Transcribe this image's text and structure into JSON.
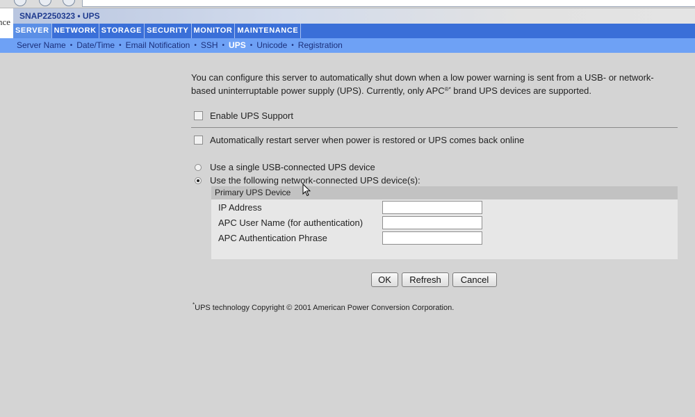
{
  "window": {
    "title": "SNAP2250323 • UPS",
    "logo_fragment": "nce"
  },
  "main_tabs": [
    {
      "label": "SERVER",
      "active": true
    },
    {
      "label": "NETWORK"
    },
    {
      "label": "STORAGE"
    },
    {
      "label": "SECURITY"
    },
    {
      "label": "MONITOR"
    },
    {
      "label": "MAINTENANCE"
    }
  ],
  "sub_nav": [
    {
      "label": "Server Name"
    },
    {
      "label": "Date/Time"
    },
    {
      "label": "Email Notification"
    },
    {
      "label": "SSH"
    },
    {
      "label": "UPS",
      "active": true
    },
    {
      "label": "Unicode"
    },
    {
      "label": "Registration"
    }
  ],
  "sub_nav_separator": "•",
  "intro": {
    "text_before": "You can configure this server to automatically shut down when a low power warning is sent from a USB- or network-based uninterruptable power supply (UPS). Currently, only APC",
    "superscript": "®*",
    "text_after": " brand UPS devices are supported."
  },
  "options": {
    "enable_ups": {
      "label": "Enable UPS Support",
      "checked": false
    },
    "auto_restart": {
      "label": "Automatically restart server when power is restored or UPS comes back online",
      "checked": false
    },
    "mode_usb": {
      "label": "Use a single USB-connected UPS device",
      "checked": false
    },
    "mode_network": {
      "label": "Use the following network-connected UPS device(s):",
      "checked": true
    }
  },
  "primary_ups": {
    "header": "Primary UPS Device",
    "fields": [
      {
        "label": "IP Address",
        "value": ""
      },
      {
        "label": "APC User Name (for authentication)",
        "value": ""
      },
      {
        "label": "APC Authentication Phrase",
        "value": ""
      }
    ]
  },
  "buttons": {
    "ok": "OK",
    "refresh": "Refresh",
    "cancel": "Cancel"
  },
  "copyright": {
    "mark": "*",
    "text": "UPS technology Copyright © 2001  American Power Conversion Corporation."
  }
}
